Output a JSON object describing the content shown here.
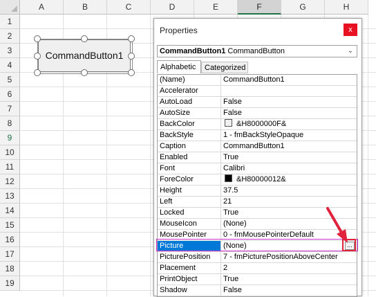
{
  "sheet": {
    "columns": [
      "A",
      "B",
      "C",
      "D",
      "E",
      "F",
      "G",
      "H"
    ],
    "selected_column": "F",
    "rows": [
      "1",
      "2",
      "3",
      "4",
      "5",
      "6",
      "7",
      "8",
      "9",
      "10",
      "11",
      "12",
      "13",
      "14",
      "15",
      "16",
      "17",
      "18",
      "19"
    ],
    "selected_row": "9"
  },
  "command_button": {
    "caption": "CommandButton1"
  },
  "properties": {
    "title": "Properties",
    "close_label": "x",
    "selector": {
      "name": "CommandButton1",
      "type": "CommandButton"
    },
    "tabs": [
      "Alphabetic",
      "Categorized"
    ],
    "active_tab": "Alphabetic",
    "rows": [
      {
        "name": "(Name)",
        "value": "CommandButton1"
      },
      {
        "name": "Accelerator",
        "value": ""
      },
      {
        "name": "AutoLoad",
        "value": "False"
      },
      {
        "name": "AutoSize",
        "value": "False"
      },
      {
        "name": "BackColor",
        "value": "&H8000000F&",
        "swatch": "#f0f0f0"
      },
      {
        "name": "BackStyle",
        "value": "1 - fmBackStyleOpaque"
      },
      {
        "name": "Caption",
        "value": "CommandButton1"
      },
      {
        "name": "Enabled",
        "value": "True"
      },
      {
        "name": "Font",
        "value": "Calibri"
      },
      {
        "name": "ForeColor",
        "value": "&H80000012&",
        "swatch": "#000000"
      },
      {
        "name": "Height",
        "value": "37.5"
      },
      {
        "name": "Left",
        "value": "21"
      },
      {
        "name": "Locked",
        "value": "True"
      },
      {
        "name": "MouseIcon",
        "value": "(None)"
      },
      {
        "name": "MousePointer",
        "value": "0 - fmMousePointerDefault"
      },
      {
        "name": "Picture",
        "value": "(None)",
        "selected": true,
        "ellipsis": "..."
      },
      {
        "name": "PicturePosition",
        "value": "7 - fmPicturePositionAboveCenter"
      },
      {
        "name": "Placement",
        "value": "2"
      },
      {
        "name": "PrintObject",
        "value": "True"
      },
      {
        "name": "Shadow",
        "value": "False"
      }
    ]
  },
  "colors": {
    "selection": "#0078d7",
    "close_button": "#e81123",
    "highlight_frame": "#cc33cc",
    "annotation_arrow": "#e0223c"
  }
}
